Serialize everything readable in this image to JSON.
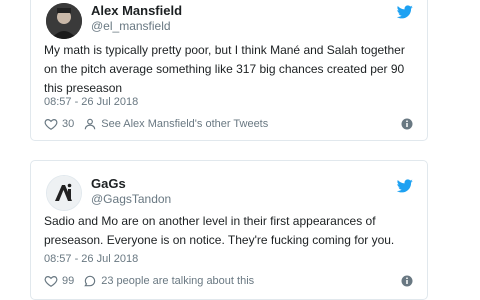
{
  "colors": {
    "twitter_blue": "#1da1f2",
    "muted": "#697882",
    "text": "#1c2022",
    "border": "#e1e8ed"
  },
  "tweets": [
    {
      "author_name": "Alex Mansfield",
      "handle": "@el_mansfield",
      "avatar_icon": "profile-photo",
      "text": "My math is typically pretty poor, but I think Mané and Salah together on the pitch average something like 317 big chances created per 90 this preseason",
      "timestamp": "08:57 - 26 Jul 2018",
      "likes": "30",
      "action_text": "See Alex Mansfield's other Tweets"
    },
    {
      "author_name": "GaGs",
      "handle": "@GagsTandon",
      "avatar_icon": "ai-logo-avatar",
      "text": "Sadio and Mo are on another level in their first appearances of preseason. Everyone is on notice. They're fucking coming for you.",
      "timestamp": "08:57 - 26 Jul 2018",
      "likes": "99",
      "action_text": "23 people are talking about this"
    }
  ]
}
